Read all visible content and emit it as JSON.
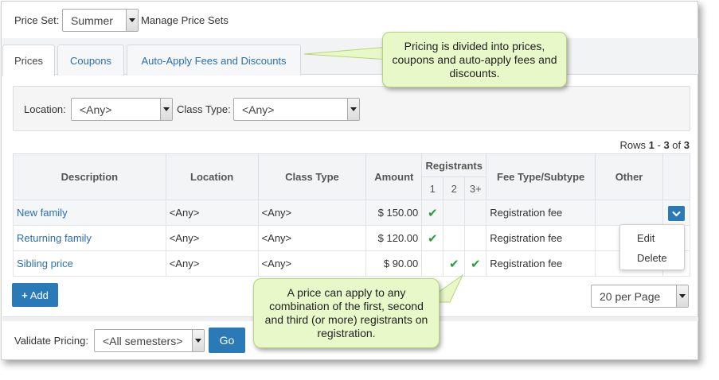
{
  "header": {
    "price_set_label": "Price Set:",
    "price_set_value": "Summer",
    "manage_link": "Manage Price Sets"
  },
  "tabs": [
    {
      "label": "Prices",
      "active": true
    },
    {
      "label": "Coupons",
      "active": false
    },
    {
      "label": "Auto-Apply Fees and Discounts",
      "active": false
    }
  ],
  "filters": {
    "location_label": "Location:",
    "location_value": "<Any>",
    "class_type_label": "Class Type:",
    "class_type_value": "<Any>"
  },
  "rows_info": {
    "prefix": "Rows ",
    "start": "1",
    "dash": " - ",
    "end": "3",
    "of": " of ",
    "total": "3"
  },
  "table": {
    "headers": {
      "description": "Description",
      "location": "Location",
      "class_type": "Class Type",
      "amount": "Amount",
      "registrants": "Registrants",
      "reg1": "1",
      "reg2": "2",
      "reg3": "3+",
      "fee_type": "Fee Type/Subtype",
      "other": "Other"
    },
    "rows": [
      {
        "description": "New family",
        "location": "<Any>",
        "class_type": "<Any>",
        "amount": "$ 150.00",
        "r1": "✔",
        "r2": "",
        "r3": "",
        "fee_type": "Registration fee"
      },
      {
        "description": "Returning family",
        "location": "<Any>",
        "class_type": "<Any>",
        "amount": "$ 120.00",
        "r1": "✔",
        "r2": "",
        "r3": "",
        "fee_type": "Registration fee"
      },
      {
        "description": "Sibling price",
        "location": "<Any>",
        "class_type": "<Any>",
        "amount": "$ 90.00",
        "r1": "",
        "r2": "✔",
        "r3": "✔",
        "fee_type": "Registration fee"
      }
    ]
  },
  "actions_menu": {
    "edit": "Edit",
    "delete": "Delete"
  },
  "add_button": "Add",
  "per_page": "20 per Page",
  "validate": {
    "label": "Validate Pricing:",
    "value": "<All semesters>",
    "go": "Go"
  },
  "callouts": {
    "top": "Pricing is divided into prices, coupons and auto-apply fees and discounts.",
    "bottom": "A price can apply to any combination of the first, second and third (or more) registrants on registration."
  },
  "colors": {
    "accent": "#2a7ab8",
    "check": "#2e9b3a",
    "callout_bg": "#e8f8c8"
  }
}
